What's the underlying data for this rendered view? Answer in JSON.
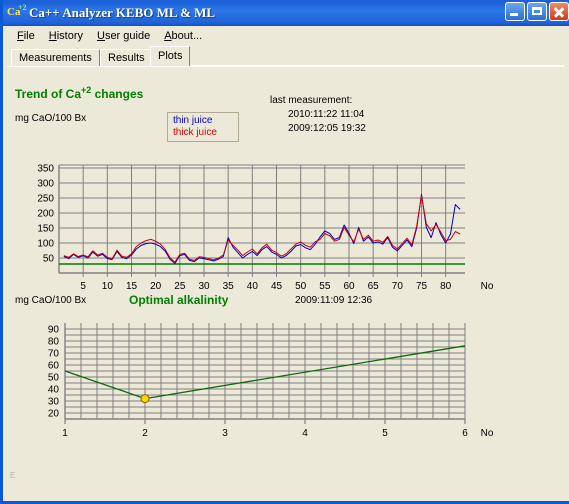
{
  "window": {
    "title": "Ca++ Analyzer KEBO ML & ML",
    "icon_main": "Ca",
    "icon_sup": "+2",
    "icon_name": "calcium-ion-icon",
    "buttons": {
      "minimize": "minimize",
      "maximize": "maximize",
      "close": "close"
    }
  },
  "menu": {
    "items": [
      {
        "label": "File",
        "accel": "F"
      },
      {
        "label": "History",
        "accel": "H"
      },
      {
        "label": "User guide",
        "accel": "U"
      },
      {
        "label": "About...",
        "accel": "A"
      }
    ]
  },
  "tabs": {
    "items": [
      {
        "label": "Measurements",
        "active": false
      },
      {
        "label": "Results",
        "active": false
      },
      {
        "label": "Plots",
        "active": true
      }
    ],
    "selected": "Plots"
  },
  "corner_mark": "E",
  "chart1_header": {
    "title_prefix": "Trend of Ca",
    "title_sup": "+2",
    "title_suffix": " changes",
    "y_unit": "mg CaO/100 Bx",
    "legend": {
      "thin": "thin juice",
      "thick": "thick juice"
    },
    "stamp_label": "last measurement:",
    "stamp_line1": "2010:11:22  11:04",
    "stamp_line2": "2009:12:05  19:32"
  },
  "chart2_header": {
    "y_unit": "mg CaO/100 Bx",
    "title": "Optimal alkalinity",
    "stamp": "2009:11:09  12:36"
  },
  "colors": {
    "thin_juice": "#0000cc",
    "thick_juice": "#cc0000",
    "threshold": "#008000",
    "optimal_line": "#116611",
    "marker_fill": "#ffd700",
    "marker_stroke": "#806000",
    "grid": "#808080",
    "plot_bg": "#ece9d8",
    "title_green": "#008000",
    "titlebar_blue": "#1d62d8"
  },
  "chart_data": [
    {
      "type": "line",
      "title": "Trend of Ca+2 changes",
      "xlabel": "No",
      "ylabel": "mg CaO/100 Bx",
      "xlim": [
        0,
        84
      ],
      "ylim": [
        0,
        360
      ],
      "yticks": [
        50,
        100,
        150,
        200,
        250,
        300,
        350
      ],
      "xticks": [
        5,
        10,
        15,
        20,
        25,
        30,
        35,
        40,
        45,
        50,
        55,
        60,
        65,
        70,
        75,
        80
      ],
      "grid": true,
      "legend_position": "top-center",
      "threshold_line": {
        "value": 30,
        "color": "#008000",
        "label": ""
      },
      "x": [
        1,
        2,
        3,
        4,
        5,
        6,
        7,
        8,
        9,
        10,
        11,
        12,
        13,
        14,
        15,
        16,
        17,
        18,
        19,
        20,
        21,
        22,
        23,
        24,
        25,
        26,
        27,
        28,
        29,
        30,
        31,
        32,
        33,
        34,
        35,
        36,
        37,
        38,
        39,
        40,
        41,
        42,
        43,
        44,
        45,
        46,
        47,
        48,
        49,
        50,
        51,
        52,
        53,
        54,
        55,
        56,
        57,
        58,
        59,
        60,
        61,
        62,
        63,
        64,
        65,
        66,
        67,
        68,
        69,
        70,
        71,
        72,
        73,
        74,
        75,
        76,
        77,
        78,
        79,
        80,
        81,
        82,
        83
      ],
      "series": [
        {
          "name": "thin juice",
          "color": "#0000cc",
          "values": [
            55,
            48,
            62,
            52,
            58,
            50,
            70,
            56,
            62,
            48,
            45,
            72,
            52,
            48,
            60,
            80,
            92,
            98,
            100,
            96,
            88,
            72,
            45,
            32,
            58,
            62,
            42,
            38,
            50,
            48,
            44,
            40,
            46,
            55,
            118,
            86,
            68,
            50,
            62,
            72,
            58,
            78,
            88,
            70,
            62,
            50,
            58,
            72,
            90,
            95,
            84,
            78,
            96,
            120,
            140,
            132,
            112,
            118,
            160,
            132,
            98,
            152,
            106,
            120,
            100,
            104,
            96,
            118,
            86,
            74,
            92,
            110,
            88,
            150,
            262,
            152,
            118,
            168,
            128,
            100,
            130,
            228,
            212
          ]
        },
        {
          "name": "thick juice",
          "color": "#cc0000",
          "values": [
            58,
            52,
            64,
            55,
            60,
            54,
            74,
            60,
            66,
            52,
            48,
            76,
            56,
            52,
            64,
            88,
            100,
            108,
            112,
            106,
            96,
            78,
            50,
            36,
            62,
            66,
            46,
            42,
            54,
            52,
            48,
            44,
            50,
            60,
            110,
            92,
            76,
            58,
            70,
            80,
            64,
            84,
            96,
            76,
            68,
            56,
            64,
            80,
            96,
            104,
            92,
            86,
            104,
            112,
            132,
            124,
            106,
            112,
            152,
            126,
            104,
            146,
            112,
            126,
            106,
            110,
            102,
            122,
            92,
            80,
            98,
            116,
            94,
            156,
            258,
            164,
            140,
            162,
            136,
            108,
            112,
            138,
            130
          ]
        }
      ]
    },
    {
      "type": "line",
      "title": "Optimal alkalinity",
      "xlabel": "No",
      "ylabel": "mg CaO/100 Bx",
      "xlim": [
        1,
        6
      ],
      "ylim": [
        15,
        95
      ],
      "yticks": [
        20,
        30,
        40,
        50,
        60,
        70,
        80,
        90
      ],
      "xticks": [
        1,
        2,
        3,
        4,
        5,
        6
      ],
      "grid": true,
      "x": [
        1,
        2,
        6
      ],
      "values": [
        55,
        32,
        76
      ],
      "marker": {
        "x": 2,
        "y": 32,
        "fill": "#ffd700",
        "stroke": "#806000"
      },
      "series": [
        {
          "name": "optimal alkalinity",
          "color": "#116611",
          "values": [
            55,
            32,
            76
          ]
        }
      ]
    }
  ]
}
